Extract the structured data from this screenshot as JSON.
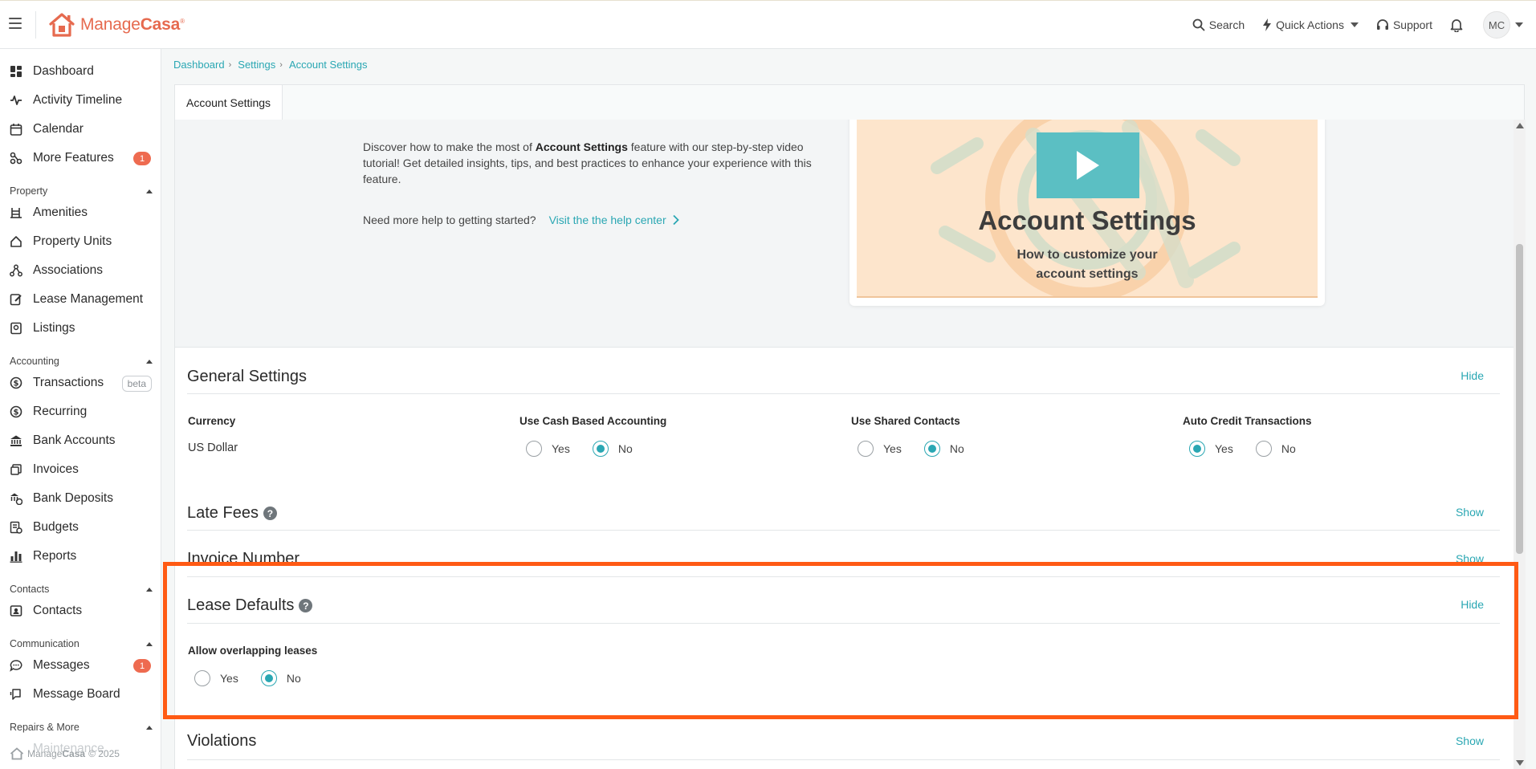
{
  "brand": {
    "logo_part1": "Manage",
    "logo_part2": "Casa",
    "logo_mark": "®",
    "accent": "#2aa7b3",
    "brand_color": "#e66a4f"
  },
  "topbar": {
    "search_label": "Search",
    "quick_actions_label": "Quick Actions",
    "support_label": "Support",
    "avatar_initials": "MC"
  },
  "sidebar": {
    "top_items": [
      {
        "label": "Dashboard",
        "icon": "dashboard-icon"
      },
      {
        "label": "Activity Timeline",
        "icon": "activity-icon"
      },
      {
        "label": "Calendar",
        "icon": "calendar-icon"
      },
      {
        "label": "More Features",
        "icon": "features-icon",
        "badge": "1"
      }
    ],
    "property_header": "Property",
    "property_items": [
      {
        "label": "Amenities",
        "icon": "amenities-icon"
      },
      {
        "label": "Property Units",
        "icon": "home-icon"
      },
      {
        "label": "Associations",
        "icon": "associations-icon"
      },
      {
        "label": "Lease Management",
        "icon": "lease-icon"
      },
      {
        "label": "Listings",
        "icon": "listings-icon"
      }
    ],
    "accounting_header": "Accounting",
    "accounting_items": [
      {
        "label": "Transactions",
        "icon": "dollar-icon",
        "tag": "beta"
      },
      {
        "label": "Recurring",
        "icon": "recurring-icon"
      },
      {
        "label": "Bank Accounts",
        "icon": "bank-icon"
      },
      {
        "label": "Invoices",
        "icon": "invoice-icon"
      },
      {
        "label": "Bank Deposits",
        "icon": "deposit-icon"
      },
      {
        "label": "Budgets",
        "icon": "budget-icon"
      },
      {
        "label": "Reports",
        "icon": "reports-icon"
      }
    ],
    "contacts_header": "Contacts",
    "contacts_items": [
      {
        "label": "Contacts",
        "icon": "contacts-icon"
      }
    ],
    "communication_header": "Communication",
    "communication_items": [
      {
        "label": "Messages",
        "icon": "messages-icon",
        "badge": "1"
      },
      {
        "label": "Message Board",
        "icon": "message-board-icon"
      }
    ],
    "repairs_header": "Repairs & More",
    "hidden_item": "Maintenance",
    "footer_brand1": "Manage",
    "footer_brand2": "Casa",
    "footer_text": "© 2025"
  },
  "breadcrumb": [
    "Dashboard",
    "Settings",
    "Account Settings"
  ],
  "tabs": [
    {
      "label": "Account Settings",
      "active": true
    }
  ],
  "help": {
    "text_before": "Discover how to make the most of ",
    "text_bold": "Account Settings",
    "text_after": " feature with our step-by-step video tutorial! Get detailed insights, tips, and best practices to enhance your experience with this feature.",
    "more_prompt": "Need more help to getting started?",
    "help_link": "Visit the the help center",
    "video_title": "Account Settings",
    "video_subtitle_line1": "How to customize your",
    "video_subtitle_line2": "account settings"
  },
  "general": {
    "title": "General Settings",
    "toggle": "Hide",
    "currency_label": "Currency",
    "currency_value": "US Dollar",
    "cash_label": "Use Cash Based Accounting",
    "cash_selected": "No",
    "shared_label": "Use Shared Contacts",
    "shared_selected": "No",
    "auto_credit_label": "Auto Credit Transactions",
    "auto_credit_selected": "Yes",
    "yes": "Yes",
    "no": "No"
  },
  "late_fees": {
    "title": "Late Fees",
    "toggle": "Show"
  },
  "invoice_number": {
    "title": "Invoice Number",
    "toggle": "Show"
  },
  "lease_defaults": {
    "title": "Lease Defaults",
    "toggle": "Hide",
    "overlap_label": "Allow overlapping leases",
    "overlap_selected": "No"
  },
  "violations": {
    "title": "Violations",
    "toggle": "Show"
  }
}
